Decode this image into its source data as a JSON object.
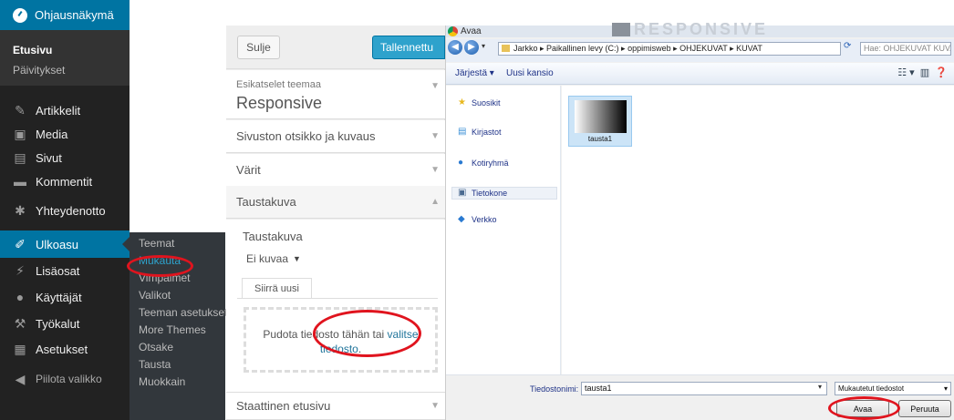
{
  "sidebar": {
    "dashboard": "Ohjausnäkymä",
    "dashboard_sub": [
      "Etusivu",
      "Päivitykset"
    ],
    "items": [
      {
        "label": "Artikkelit",
        "icon": "pin-icon"
      },
      {
        "label": "Media",
        "icon": "media-icon"
      },
      {
        "label": "Sivut",
        "icon": "pages-icon"
      },
      {
        "label": "Kommentit",
        "icon": "comment-icon"
      },
      {
        "label": "Yhteydenotto",
        "icon": "contact-icon"
      },
      {
        "label": "Ulkoasu",
        "icon": "brush-icon",
        "active": true
      },
      {
        "label": "Lisäosat",
        "icon": "plugin-icon"
      },
      {
        "label": "Käyttäjät",
        "icon": "user-icon"
      },
      {
        "label": "Työkalut",
        "icon": "wrench-icon"
      },
      {
        "label": "Asetukset",
        "icon": "settings-icon"
      }
    ],
    "collapse": "Piilota valikko",
    "submenu": [
      "Teemat",
      "Mukauta",
      "Vimpaimet",
      "Valikot",
      "Teeman asetukset",
      "More Themes",
      "Otsake",
      "Tausta",
      "Muokkain"
    ],
    "submenu_current": "Mukauta"
  },
  "customizer": {
    "close": "Sulje",
    "saved": "Tallennettu",
    "preview_label": "Esikatselet teemaa",
    "theme_name": "Responsive",
    "sections": [
      "Sivuston otsikko ja kuvaus",
      "Värit",
      "Taustakuva"
    ],
    "open_section": "Taustakuva",
    "bg_label": "Taustakuva",
    "no_image": "Ei kuvaa",
    "upload_tab": "Siirrä uusi",
    "drop_text": "Pudota tiedosto tähän tai",
    "drop_link": "valitse tiedosto",
    "drop_end": ".",
    "last_section": "Staattinen etusivu"
  },
  "dialog": {
    "title": "Avaa",
    "watermark": "RESPONSIVE",
    "address": "Jarkko  ▸  Paikallinen levy (C:)  ▸  oppimisweb  ▸  OHJEKUVAT  ▸  KUVAT",
    "search_placeholder": "Hae: OHJEKUVAT KUVAT",
    "toolbar_organize": "Järjestä ▾",
    "toolbar_new_folder": "Uusi kansio",
    "nav": [
      {
        "label": "Suosikit",
        "icon": "star-icon"
      },
      {
        "label": "Kirjastot",
        "icon": "library-icon"
      },
      {
        "label": "Kotiryhmä",
        "icon": "homegroup-icon"
      },
      {
        "label": "Tietokone",
        "icon": "computer-icon",
        "selected": true
      },
      {
        "label": "Verkko",
        "icon": "network-icon"
      }
    ],
    "file_name": "tausta1",
    "filename_label": "Tiedostonimi:",
    "filename_value": "tausta1",
    "filter": "Mukautetut tiedostot",
    "open": "Avaa",
    "cancel": "Peruuta"
  },
  "colors": {
    "admin_dark": "#222222",
    "accent": "#0074a2",
    "annotation": "#e0141e"
  }
}
